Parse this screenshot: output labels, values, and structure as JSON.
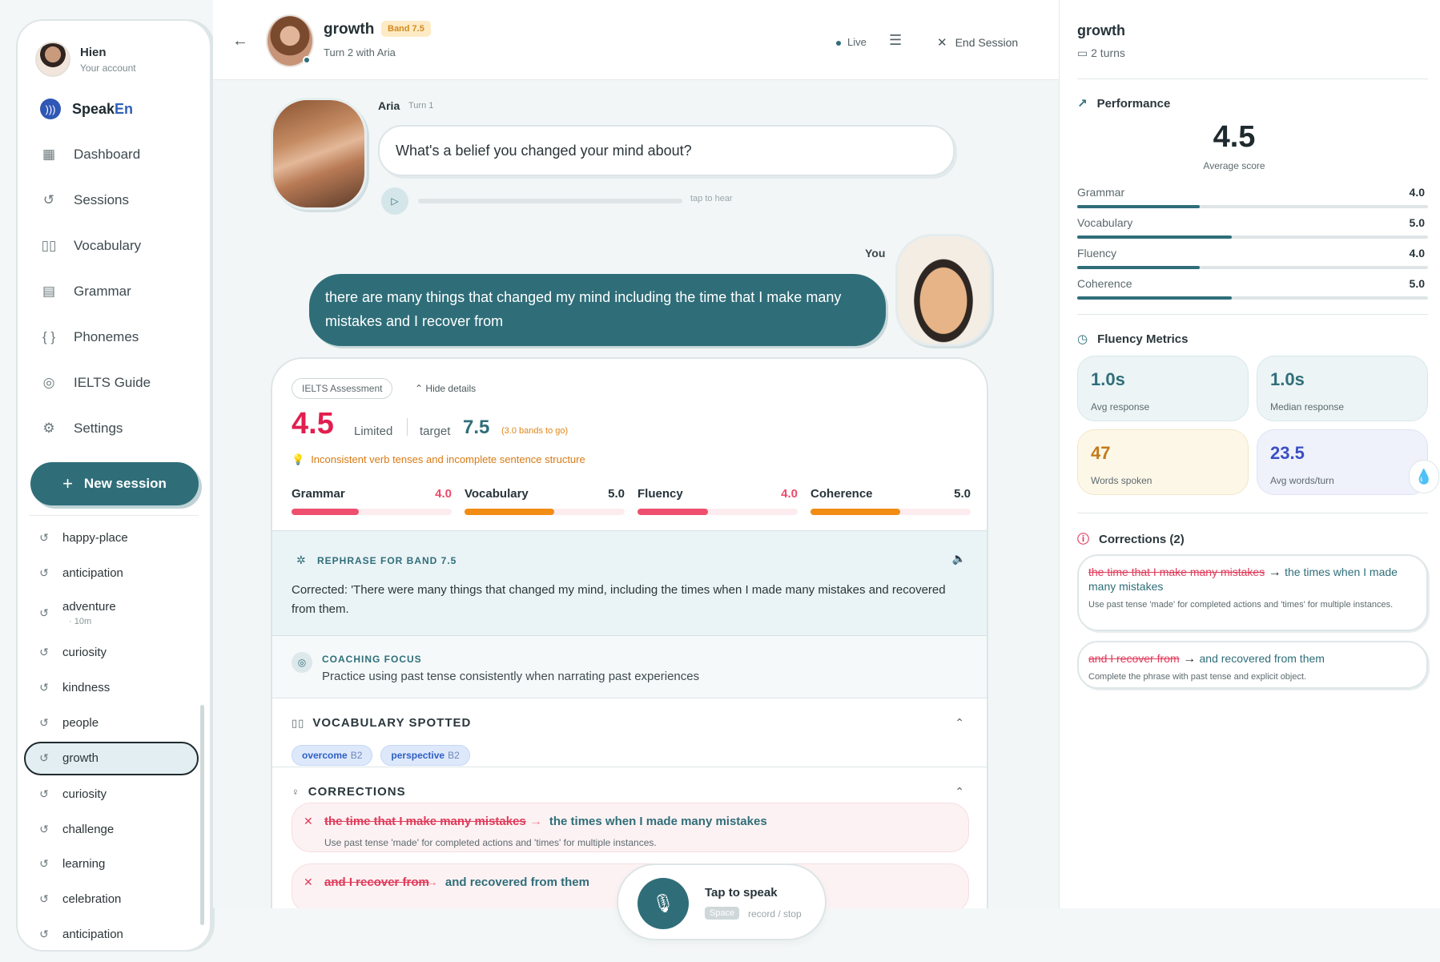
{
  "user": {
    "name": "Hien",
    "subtitle": "Your account"
  },
  "brand": {
    "name_a": "Speak",
    "name_b": "En"
  },
  "nav": [
    {
      "label": "Dashboard",
      "icon": "grid-icon"
    },
    {
      "label": "Sessions",
      "icon": "history-icon"
    },
    {
      "label": "Vocabulary",
      "icon": "book-icon"
    },
    {
      "label": "Grammar",
      "icon": "notebook-icon"
    },
    {
      "label": "Phonemes",
      "icon": "braces-icon"
    },
    {
      "label": "IELTS Guide",
      "icon": "target-icon"
    },
    {
      "label": "Settings",
      "icon": "gear-icon"
    }
  ],
  "new_session_label": "New session",
  "history": [
    {
      "label": "happy-place"
    },
    {
      "label": "anticipation"
    },
    {
      "label": "adventure",
      "sub": "· 10m"
    },
    {
      "label": "curiosity"
    },
    {
      "label": "kindness"
    },
    {
      "label": "people"
    },
    {
      "label": "growth",
      "active": true
    },
    {
      "label": "curiosity"
    },
    {
      "label": "challenge"
    },
    {
      "label": "learning"
    },
    {
      "label": "celebration"
    },
    {
      "label": "anticipation"
    }
  ],
  "header": {
    "topic": "growth",
    "band_badge": "Band 7.5",
    "turn_info": "Turn 2 with Aria",
    "live": "Live",
    "end_session": "End Session"
  },
  "aria": {
    "name": "Aria",
    "turn": "Turn 1",
    "question": "What's a belief you changed your mind about?",
    "tap_to_hear": "tap to hear"
  },
  "you": {
    "label": "You",
    "answer": "there are many things that changed my mind including the time that I make many mistakes and I recover from"
  },
  "assessment": {
    "tag": "IELTS Assessment",
    "hide_details": "Hide details",
    "score": "4.5",
    "level": "Limited",
    "target_label": "target",
    "target": "7.5",
    "bands_to_go": "(3.0 bands to go)",
    "feedback": "Inconsistent verb tenses and incomplete sentence structure",
    "criteria": [
      {
        "label": "Grammar",
        "value": "4.0",
        "fraction": 0.42,
        "color": "#ef4f6e",
        "red": true
      },
      {
        "label": "Vocabulary",
        "value": "5.0",
        "fraction": 0.56,
        "color": "#f18c14",
        "red": false
      },
      {
        "label": "Fluency",
        "value": "4.0",
        "fraction": 0.44,
        "color": "#ef4f6e",
        "red": true
      },
      {
        "label": "Coherence",
        "value": "5.0",
        "fraction": 0.56,
        "color": "#f18c14",
        "red": false
      }
    ],
    "rephrase_title": "REPHRASE FOR BAND 7.5",
    "corrected": "Corrected: 'There were many things that changed my mind, including the times when I made many mistakes and recovered from them.",
    "coaching_title": "COACHING FOCUS",
    "coaching_text": "Practice using past tense consistently when narrating past experiences",
    "vocab_title": "VOCABULARY SPOTTED",
    "vocab": [
      {
        "word": "overcome",
        "level": "B2"
      },
      {
        "word": "perspective",
        "level": "B2"
      }
    ],
    "corrections_title": "CORRECTIONS",
    "corrections": [
      {
        "wrong": "the time that I make many mistakes",
        "right": "the times when I made many mistakes",
        "note": "Use past tense 'made' for completed actions and 'times' for multiple instances."
      },
      {
        "wrong": "and I recover from",
        "right": "and recovered from them",
        "note": ""
      }
    ]
  },
  "speak": {
    "label": "Tap to speak",
    "key": "Space",
    "hint": "record / stop"
  },
  "right": {
    "title": "growth",
    "turns": "2 turns",
    "performance_title": "Performance",
    "avg_score": "4.5",
    "avg_label": "Average score",
    "perf": [
      {
        "label": "Grammar",
        "value": "4.0",
        "fraction": 0.35
      },
      {
        "label": "Vocabulary",
        "value": "5.0",
        "fraction": 0.44
      },
      {
        "label": "Fluency",
        "value": "4.0",
        "fraction": 0.35
      },
      {
        "label": "Coherence",
        "value": "5.0",
        "fraction": 0.44
      }
    ],
    "fluency_title": "Fluency Metrics",
    "metrics": [
      {
        "value": "1.0s",
        "label": "Avg response",
        "style": "m-blue"
      },
      {
        "value": "1.0s",
        "label": "Median response",
        "style": "m-blue"
      },
      {
        "value": "47",
        "label": "Words spoken",
        "style": "m-yellow"
      },
      {
        "value": "23.5",
        "label": "Avg words/turn",
        "style": "m-lav"
      }
    ],
    "corrections_title": "Corrections (2)",
    "corrections": [
      {
        "wrong": "the time that I make many mistakes",
        "right": "the times when I made many mistakes",
        "note": "Use past tense 'made' for completed actions and 'times' for multiple instances."
      },
      {
        "wrong": "and I recover from",
        "right": "and recovered from them",
        "note": "Complete the phrase with past tense and explicit object."
      }
    ]
  }
}
